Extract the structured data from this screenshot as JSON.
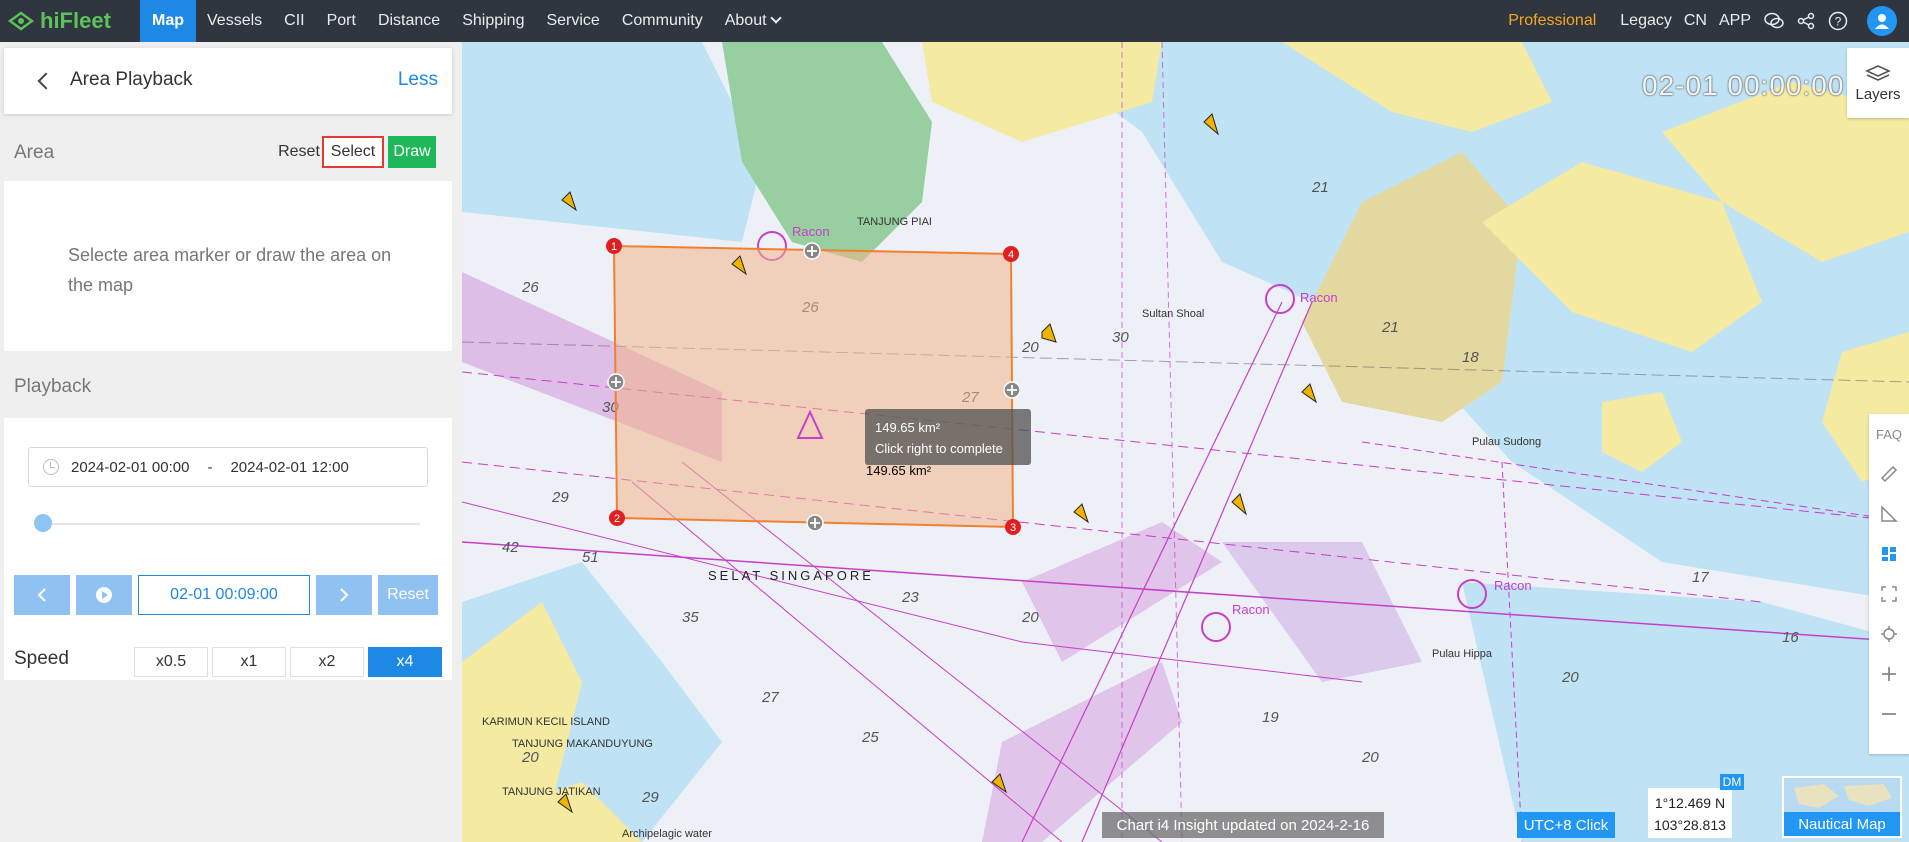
{
  "app": {
    "name": "hiFleet"
  },
  "nav": {
    "items": [
      "Map",
      "Vessels",
      "CII",
      "Port",
      "Distance",
      "Shipping",
      "Service",
      "Community",
      "About"
    ],
    "active": "Map"
  },
  "right_nav": {
    "professional": "Professional",
    "legacy": "Legacy",
    "cn": "CN",
    "app": "APP"
  },
  "panel": {
    "title": "Area Playback",
    "less": "Less",
    "area_label": "Area",
    "reset": "Reset",
    "select": "Select",
    "draw": "Draw",
    "hint": "Selecte area marker or draw the area on the map",
    "playback_label": "Playback",
    "date_start": "2024-02-01 00:00",
    "date_sep": "-",
    "date_end": "2024-02-01 12:00",
    "progress": 0.0,
    "current_time": "02-01 00:09:00",
    "reset_playback": "Reset",
    "speed_label": "Speed",
    "speeds": [
      "x0.5",
      "x1",
      "x2",
      "x4"
    ],
    "speed_active": "x4"
  },
  "map": {
    "time_display": "02-01 00:00:00",
    "layers": "Layers",
    "tooltip_area": "149.65 km²",
    "tooltip_hint": "Click right to complete",
    "area_label": "149.65 km²",
    "vertices": [
      "1",
      "2",
      "3",
      "4"
    ],
    "faq": "FAQ",
    "chart_note": "Chart i4 Insight updated on 2024-2-16",
    "utc": "UTC+8 Click",
    "lat": "1°12.469 N",
    "lon": "103°28.813 E",
    "dm": "DM",
    "nautical_map": "Nautical Map",
    "place_labels": [
      "SELAT SINGAPORE",
      "TANJUNG PIAI",
      "Sultan Shoal",
      "Pulau Sudong",
      "KARIMUN KECIL ISLAND",
      "TANJUNG MAKANDUYUNG",
      "TANJUNG JATIKAN",
      "Archipelagic water",
      "Pulau Hippa",
      "Racon",
      "Racon",
      "Racon",
      "Racon"
    ]
  }
}
